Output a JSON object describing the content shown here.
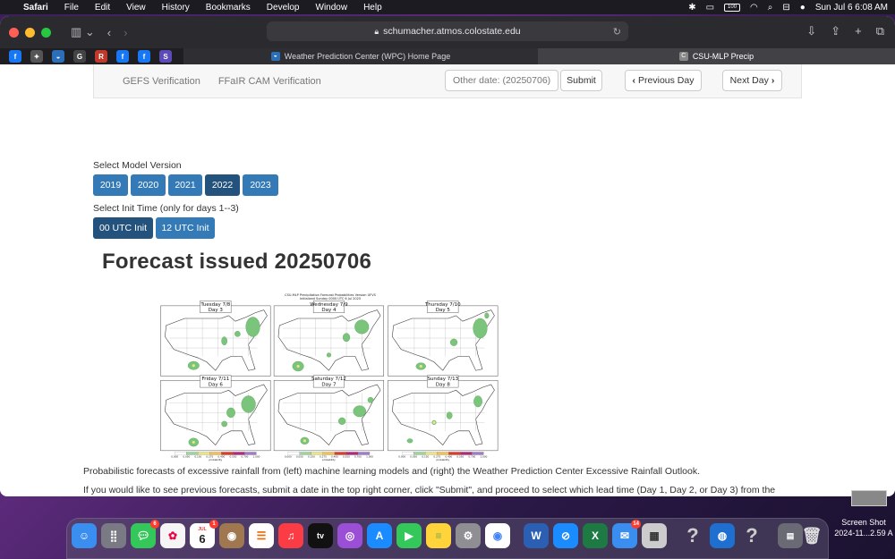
{
  "menubar": {
    "app": "Safari",
    "items": [
      "File",
      "Edit",
      "View",
      "History",
      "Bookmarks",
      "Develop",
      "Window",
      "Help"
    ],
    "battery": "100",
    "clock": "Sun Jul 6  6:08 AM"
  },
  "browser": {
    "url": "schumacher.atmos.colostate.edu",
    "tabs": [
      {
        "title": "Weather Prediction Center (WPC) Home Page"
      },
      {
        "title": "CSU-MLP Precip"
      }
    ],
    "favorites": [
      {
        "letter": "f",
        "color": "#1877f2"
      },
      {
        "letter": "✦",
        "color": "#555555"
      },
      {
        "letter": "◒",
        "color": "#2a6fb8"
      },
      {
        "letter": "G",
        "color": "#444444"
      },
      {
        "letter": "R",
        "color": "#c0392b"
      },
      {
        "letter": "f",
        "color": "#1877f2"
      },
      {
        "letter": "f",
        "color": "#1877f2"
      },
      {
        "letter": "S",
        "color": "#5b4ab8"
      }
    ]
  },
  "nav": {
    "links": [
      "GEFS Verification",
      "FFaIR CAM Verification"
    ],
    "date_placeholder": "Other date: (20250706)",
    "submit": "Submit",
    "prev": "Previous Day",
    "next": "Next Day"
  },
  "model": {
    "label": "Select Model Version",
    "versions": [
      "2019",
      "2020",
      "2021",
      "2022",
      "2023"
    ],
    "selected": "2022"
  },
  "init": {
    "label": "Select Init Time (only for days 1--3)",
    "options": [
      "00 UTC Init",
      "12 UTC Init"
    ],
    "selected": "00 UTC Init"
  },
  "forecast": {
    "title": "Forecast issued 20250706",
    "figure_title": "CSU-MLP Precipitation Forecast Probabilities Version UFVS",
    "figure_subtitle": "Initialized Sunday 0000 UTC 6 Jul 2025",
    "panels": [
      {
        "date": "Tuesday 7/8",
        "day": "Day 3"
      },
      {
        "date": "Wednesday 7/9",
        "day": "Day 4"
      },
      {
        "date": "Thursday 7/10",
        "day": "Day 5"
      },
      {
        "date": "Friday 7/11",
        "day": "Day 6"
      },
      {
        "date": "Saturday 7/12",
        "day": "Day 7"
      },
      {
        "date": "Sunday 7/13",
        "day": "Day 8"
      }
    ],
    "colorbar_ticks": [
      "0.000",
      "0.050",
      "0.150",
      "0.275",
      "0.400",
      "0.550",
      "0.700",
      "1.000"
    ],
    "colorbar_colors": [
      "#ffffff",
      "#9fd39f",
      "#e8e58a",
      "#f0c05a",
      "#d63f2e",
      "#b02a7a",
      "#a07cc8"
    ],
    "colorbar_label": "probability"
  },
  "description": {
    "p1": "Probabilistic forecasts of excessive rainfall from (left) machine learning models and (right) the Weather Prediction Center Excessive Rainfall Outlook.",
    "p2": "If you would like to see previous forecasts, submit a date in the top right corner, click \"Submit\", and proceed to select which lead time (Day 1, Day 2, or Day 3) from the navigation bar to display the desired forecast product."
  },
  "dock": {
    "calendar_month": "JUL",
    "calendar_day": "6",
    "badges": {
      "messages": "6",
      "calendar": "1",
      "mail": "14"
    },
    "screenshot_label": "Screen Shot 2024-11...2.59 A"
  }
}
